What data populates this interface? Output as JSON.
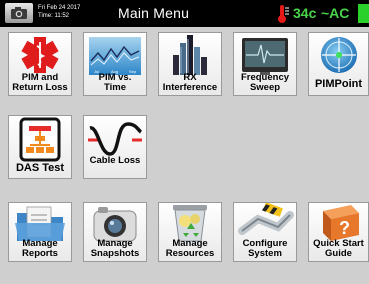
{
  "header": {
    "date": "Fri Feb 24 2017",
    "time": "Time: 11:52",
    "title": "Main Menu",
    "temperature": "34c",
    "power_source": "~AC",
    "battery_color": "#2bd12b"
  },
  "tiles": [
    {
      "label_lines": [
        "PIM and",
        "Return Loss"
      ],
      "icon": "medical-star-icon"
    },
    {
      "label_lines": [
        "PIM vs.",
        "Time"
      ],
      "icon": "waveform-chart-icon",
      "icon_text": [
        "Jul",
        "Aug",
        "Sep"
      ]
    },
    {
      "label_lines": [
        "RX",
        "Interference"
      ],
      "icon": "skyline-bars-icon"
    },
    {
      "label_lines": [
        "Frequency",
        "Sweep"
      ],
      "icon": "oscilloscope-monitor-icon"
    },
    {
      "label_lines": [
        "PIMPoint"
      ],
      "icon": "crosshair-target-icon"
    },
    {
      "label_lines": [
        "DAS Test"
      ],
      "icon": "network-diagram-icon"
    },
    {
      "label_lines": [
        "Cable Loss"
      ],
      "icon": "cable-loss-wave-icon"
    },
    {
      "label_lines": [
        "Manage",
        "Reports"
      ],
      "icon": "folder-report-icon"
    },
    {
      "label_lines": [
        "Manage",
        "Snapshots"
      ],
      "icon": "camera-icon"
    },
    {
      "label_lines": [
        "Manage",
        "Resources"
      ],
      "icon": "recycle-bin-icon"
    },
    {
      "label_lines": [
        "Configure",
        "System"
      ],
      "icon": "wrench-settings-icon"
    },
    {
      "label_lines": [
        "Quick Start",
        "Guide"
      ],
      "icon": "help-book-icon"
    }
  ],
  "colors": {
    "header_bg": "#000000",
    "status_green": "#49d34a",
    "thermometer_red": "#e31919",
    "background": "#cfcfcf"
  }
}
